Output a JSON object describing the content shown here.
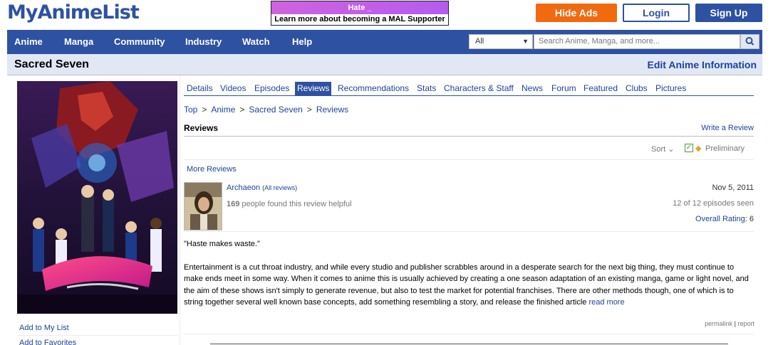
{
  "header": {
    "logo": "MyAnimeList",
    "banner_top": "Hate _",
    "banner_bottom": "Learn more about becoming a MAL Supporter",
    "hide_ads": "Hide Ads",
    "login": "Login",
    "signup": "Sign Up"
  },
  "nav": {
    "items": [
      "Anime",
      "Manga",
      "Community",
      "Industry",
      "Watch",
      "Help"
    ],
    "search_category": "All",
    "search_placeholder": "Search Anime, Manga, and more..."
  },
  "title": {
    "name": "Sacred Seven",
    "edit": "Edit Anime Information"
  },
  "left": {
    "add_list": "Add to My List",
    "add_fav": "Add to Favorites"
  },
  "tabs": [
    "Details",
    "Videos",
    "Episodes",
    "Reviews",
    "Recommendations",
    "Stats",
    "Characters & Staff",
    "News",
    "Forum",
    "Featured",
    "Clubs",
    "Pictures"
  ],
  "active_tab": "Reviews",
  "breadcrumb": [
    "Top",
    "Anime",
    "Sacred Seven",
    "Reviews"
  ],
  "reviews": {
    "heading": "Reviews",
    "write": "Write a Review",
    "sort": "Sort",
    "preliminary": "Preliminary",
    "more": "More Reviews"
  },
  "review": {
    "author": "Archaeon",
    "all_reviews": "All reviews",
    "helpful_count": "169",
    "helpful_text": "people found this review helpful",
    "date": "Nov 5, 2011",
    "episodes": "12 of 12 episodes seen",
    "rating_label": "Overall Rating",
    "rating_value": "6",
    "quote": "\"Haste makes waste.\"",
    "body": "Entertainment is a cut throat industry, and while every studio and publisher scrabbles around in a desperate search for the next big thing, they must continue to make ends meet in some way. When it comes to anime this is usually achieved by creating a one season adaptation of an existing manga, game or light novel, and the aim of these shows isn't simply to generate revenue, but also to test the market for potential franchises. There are other methods though, one of which is to string together several well known base concepts, add something resembling a story, and release the finished article",
    "read_more": "read more",
    "permalink": "permalink",
    "report": "report"
  },
  "colors": {
    "brand": "#2e51a2",
    "accent": "#f26a10",
    "title_bg": "#e1e7f5"
  }
}
